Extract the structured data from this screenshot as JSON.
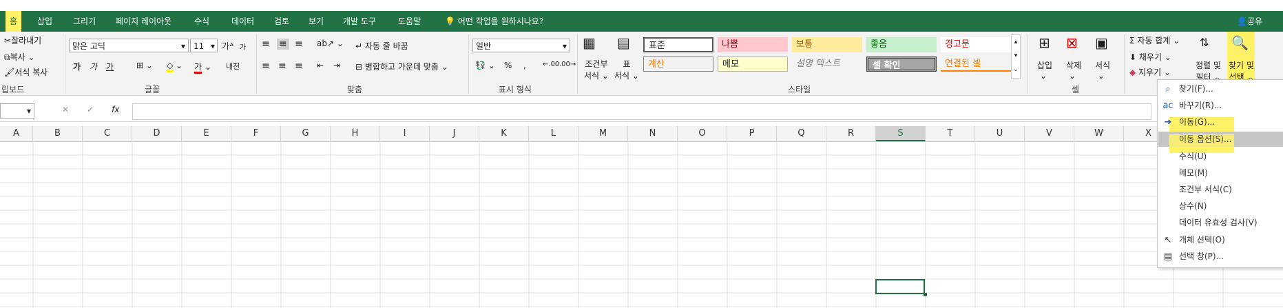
{
  "tabs": [
    {
      "label": "홈",
      "active": true
    },
    {
      "label": "삽입"
    },
    {
      "label": "그리기"
    },
    {
      "label": "페이지 레이아웃"
    },
    {
      "label": "수식"
    },
    {
      "label": "데이터"
    },
    {
      "label": "검토"
    },
    {
      "label": "보기"
    },
    {
      "label": "개발 도구"
    },
    {
      "label": "도움말"
    }
  ],
  "tell_me": "어떤 작업을 원하시나요?",
  "share": "공유",
  "clipboard": {
    "cut": "잘라내기",
    "copy": "복사",
    "format_painter": "서식 복사",
    "label": "립보드"
  },
  "font": {
    "name": "맑은 고딕",
    "size": "11",
    "bold": "가",
    "italic": "가",
    "underline": "가",
    "label": "글꼴",
    "grow": "가",
    "shrink": "가",
    "phonetic": "내천",
    "fontcolor": "가"
  },
  "alignment": {
    "wrap": "자동 줄 바꿈",
    "merge": "병합하고 가운데 맞춤",
    "label": "맞춤"
  },
  "number": {
    "format": "일반",
    "percent": "%",
    "comma": ",",
    "inc": ".00",
    "dec": ".00",
    "label": "표시 형식"
  },
  "styles": {
    "conditional": "조건부 서식",
    "conditional_1": "조건부",
    "conditional_2": "서식",
    "table": "표 서식",
    "table_1": "표",
    "table_2": "서식",
    "cells": [
      {
        "label": "표준"
      },
      {
        "label": "나쁨"
      },
      {
        "label": "보통"
      },
      {
        "label": "좋음"
      },
      {
        "label": "경고문"
      },
      {
        "label": "계산"
      },
      {
        "label": "메모"
      },
      {
        "label": "설명 텍스트"
      },
      {
        "label": "셀 확인"
      },
      {
        "label": "연결된 셀"
      }
    ],
    "label": "스타일"
  },
  "cells_group": {
    "insert": "삽입",
    "delete": "삭제",
    "format": "서식",
    "label": "셀"
  },
  "editing": {
    "autosum": "자동 합계",
    "fill": "채우기",
    "clear": "지우기",
    "sort": "정렬 및 필터",
    "sort_1": "정렬 및",
    "sort_2": "필터",
    "find": "찾기 및 선택",
    "find_1": "찾기 및",
    "find_2": "선택"
  },
  "formula_bar": {
    "fx": "fx",
    "name_box": ""
  },
  "columns": [
    "A",
    "B",
    "C",
    "D",
    "E",
    "F",
    "G",
    "H",
    "I",
    "J",
    "K",
    "L",
    "M",
    "N",
    "O",
    "P",
    "Q",
    "R",
    "S",
    "T",
    "U",
    "V",
    "W",
    "X"
  ],
  "selected_column": "S",
  "menu": [
    {
      "label": "찾기(F)...",
      "icon": "search-icon"
    },
    {
      "label": "바꾸기(R)...",
      "icon": "replace-icon"
    },
    {
      "label": "이동(G)...",
      "icon": "arrow-right-icon"
    },
    {
      "label": "이동 옵션(S)...",
      "icon": ""
    },
    {
      "label": "수식(U)",
      "icon": ""
    },
    {
      "label": "메모(M)",
      "icon": ""
    },
    {
      "label": "조건부 서식(C)",
      "icon": ""
    },
    {
      "label": "상수(N)",
      "icon": ""
    },
    {
      "label": "데이터 유효성 검사(V)",
      "icon": ""
    },
    {
      "label": "개체 선택(O)",
      "icon": "cursor-icon"
    },
    {
      "label": "선택 창(P)...",
      "icon": "selection-pane-icon"
    }
  ],
  "colors": {
    "accent": "#217346",
    "highlight": "#fff267"
  }
}
